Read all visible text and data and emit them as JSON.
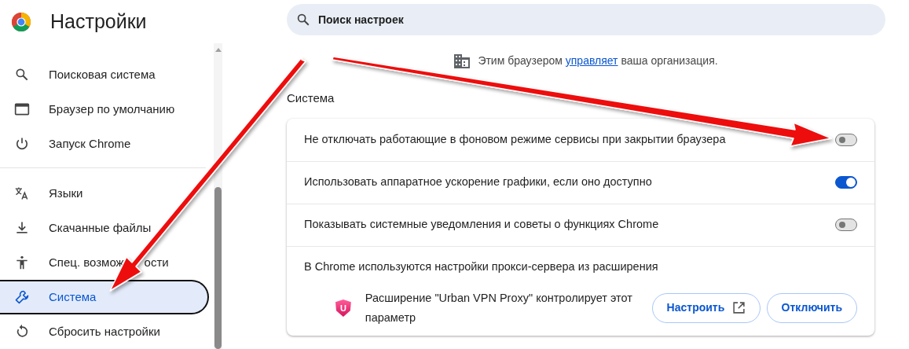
{
  "header": {
    "title": "Настройки"
  },
  "search": {
    "placeholder": "Поиск настроек"
  },
  "sidebar": {
    "groups": [
      {
        "items": [
          {
            "label": "Поисковая система",
            "kind": "search",
            "selected": false
          },
          {
            "label": "Браузер по умолчанию",
            "kind": "window",
            "selected": false
          },
          {
            "label": "Запуск Chrome",
            "kind": "power",
            "selected": false
          }
        ]
      },
      {
        "items": [
          {
            "label": "Языки",
            "kind": "translate",
            "selected": false
          },
          {
            "label": "Скачанные файлы",
            "kind": "download",
            "selected": false
          },
          {
            "label": "Спец. возмож",
            "label_end": "ости",
            "kind": "accessibility",
            "selected": false
          },
          {
            "label": "Система",
            "kind": "wrench",
            "selected": true
          },
          {
            "label": "Сбросить настройки",
            "kind": "reset",
            "selected": false
          }
        ]
      }
    ]
  },
  "managed_notice": {
    "before": "Этим браузером ",
    "link": "управляет",
    "after": " ваша организация."
  },
  "section_title": "Система",
  "settings": [
    {
      "kind": "toggle",
      "label": "Не отключать работающие в фоновом режиме сервисы при закрытии браузера",
      "on": false
    },
    {
      "kind": "toggle",
      "label": "Использовать аппаратное ускорение графики, если оно доступно",
      "on": true
    },
    {
      "kind": "toggle",
      "label": "Показывать системные уведомления и советы о функциях Chrome",
      "on": false
    },
    {
      "kind": "extension",
      "label": "В Chrome используются настройки прокси-сервера из расширения",
      "logo_letter": "U",
      "extension_text": "Расширение \"Urban VPN Proxy\" контролирует этот параметр",
      "buttons": [
        {
          "label": "Настроить",
          "kind": "external"
        },
        {
          "label": "Отключить",
          "kind": "plain"
        }
      ]
    }
  ]
}
